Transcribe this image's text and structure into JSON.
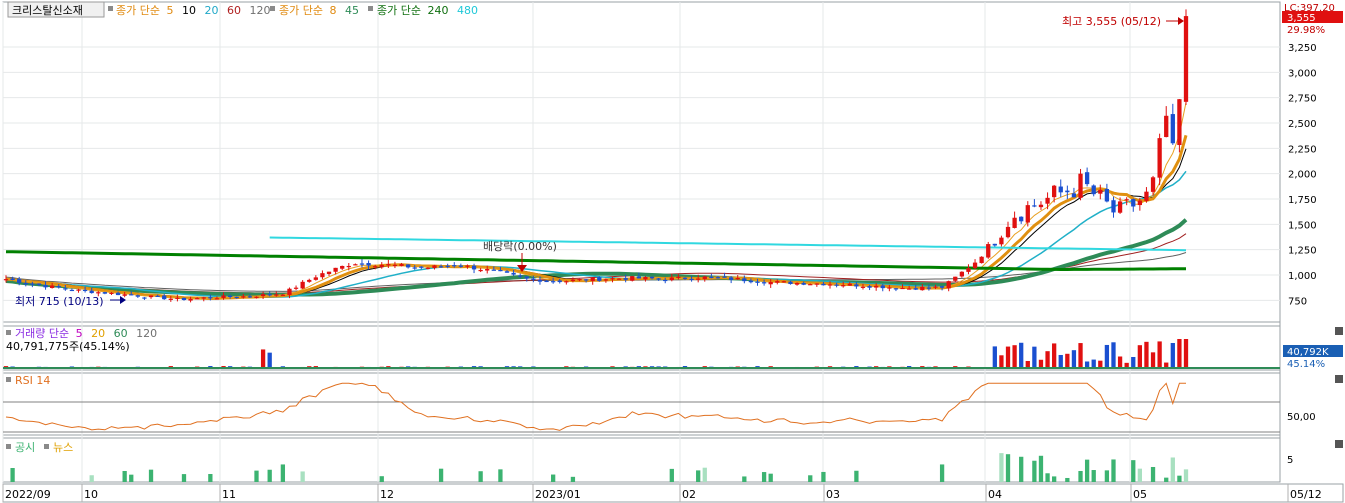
{
  "stock_name": "크리스탈신소재",
  "price_legend": {
    "group1_label": "종가 단순",
    "group1_periods": [
      "5",
      "10",
      "20",
      "60",
      "120"
    ],
    "group2_label": "종가 단순",
    "group2_periods": [
      "8",
      "45"
    ],
    "group3_label": "종가 단순",
    "group3_periods": [
      "240",
      "480"
    ],
    "colors": {
      "ma5": "#e8a020",
      "ma10": "#000000",
      "ma20": "#20b0c8",
      "ma60": "#a02020",
      "ma120": "#606060",
      "ma8": "#e09010",
      "ma45": "#2e8b57",
      "ma240": "#008000",
      "ma480": "#30d8e0"
    }
  },
  "annotations": {
    "high": "최고 3,555 (05/12)",
    "low": "최저 715 (10/13)",
    "dividend": "배당락(0.00%)"
  },
  "right_labels": {
    "lc": "LC:397.20",
    "price": "3,555",
    "change": "29.98%",
    "volume_value": "40,792K",
    "volume_change": "45.14%"
  },
  "volume_legend": {
    "label": "거래량 단순",
    "periods": [
      "5",
      "20",
      "60",
      "120"
    ],
    "current": "40,791,775주(45.14%)"
  },
  "rsi_legend": {
    "label": "RSI 14",
    "tick": "50,00"
  },
  "news_legend": {
    "disclosure": "공시",
    "news": "뉴스",
    "tick": "5"
  },
  "x_axis_labels": [
    "2022/09",
    "10",
    "11",
    "12",
    "2023/01",
    "02",
    "03",
    "04",
    "05",
    "05/12"
  ],
  "chart_data": {
    "type": "candlestick",
    "title": "크리스탈신소재",
    "y_ticks": [
      750,
      1000,
      1250,
      1500,
      1750,
      2000,
      2250,
      2500,
      2750,
      3000,
      3250
    ],
    "y_tick_labels": [
      "750",
      "1,000",
      "1,250",
      "1,500",
      "1,750",
      "2,000",
      "2,250",
      "2,500",
      "2,750",
      "3,000",
      "3,250"
    ],
    "ylim": [
      500,
      3650
    ],
    "grid": true,
    "price_path_weekly": [
      {
        "period": "2022/09 w1",
        "close": 960
      },
      {
        "period": "2022/09 w2",
        "close": 900
      },
      {
        "period": "2022/09 w3",
        "close": 850
      },
      {
        "period": "2022/09 w4",
        "close": 820
      },
      {
        "period": "2022/10 w1",
        "close": 790
      },
      {
        "period": "2022/10 w2",
        "close": 760
      },
      {
        "period": "2022/10 w3",
        "close": 780
      },
      {
        "period": "2022/10 w4",
        "close": 790
      },
      {
        "period": "2022/11 w1",
        "close": 820
      },
      {
        "period": "2022/11 w2",
        "close": 1000
      },
      {
        "period": "2022/11 w3",
        "close": 1120
      },
      {
        "period": "2022/11 w4",
        "close": 1100
      },
      {
        "period": "2022/12 w1",
        "close": 1070
      },
      {
        "period": "2022/12 w2",
        "close": 1100
      },
      {
        "period": "2022/12 w3",
        "close": 1040
      },
      {
        "period": "2022/12 w4",
        "close": 960
      },
      {
        "period": "2023/01 w1",
        "close": 940
      },
      {
        "period": "2023/01 w2",
        "close": 960
      },
      {
        "period": "2023/01 w3",
        "close": 970
      },
      {
        "period": "2023/01 w4",
        "close": 960
      },
      {
        "period": "2023/02 w1",
        "close": 980
      },
      {
        "period": "2023/02 w2",
        "close": 960
      },
      {
        "period": "2023/02 w3",
        "close": 930
      },
      {
        "period": "2023/02 w4",
        "close": 920
      },
      {
        "period": "2023/03 w1",
        "close": 910
      },
      {
        "period": "2023/03 w2",
        "close": 890
      },
      {
        "period": "2023/03 w3",
        "close": 870
      },
      {
        "period": "2023/03 w4",
        "close": 880
      },
      {
        "period": "2023/04 w1",
        "close": 1150
      },
      {
        "period": "2023/04 w2",
        "close": 1600
      },
      {
        "period": "2023/04 w3",
        "close": 1750
      },
      {
        "period": "2023/04 w4",
        "close": 1900
      },
      {
        "period": "2023/05 w1",
        "close": 1600
      },
      {
        "period": "2023/05 w2",
        "close": 1800
      },
      {
        "period": "2023/05/12",
        "close": 3555
      }
    ],
    "high": {
      "value": 3555,
      "date": "05/12"
    },
    "low": {
      "value": 715,
      "date": "10/13"
    }
  }
}
